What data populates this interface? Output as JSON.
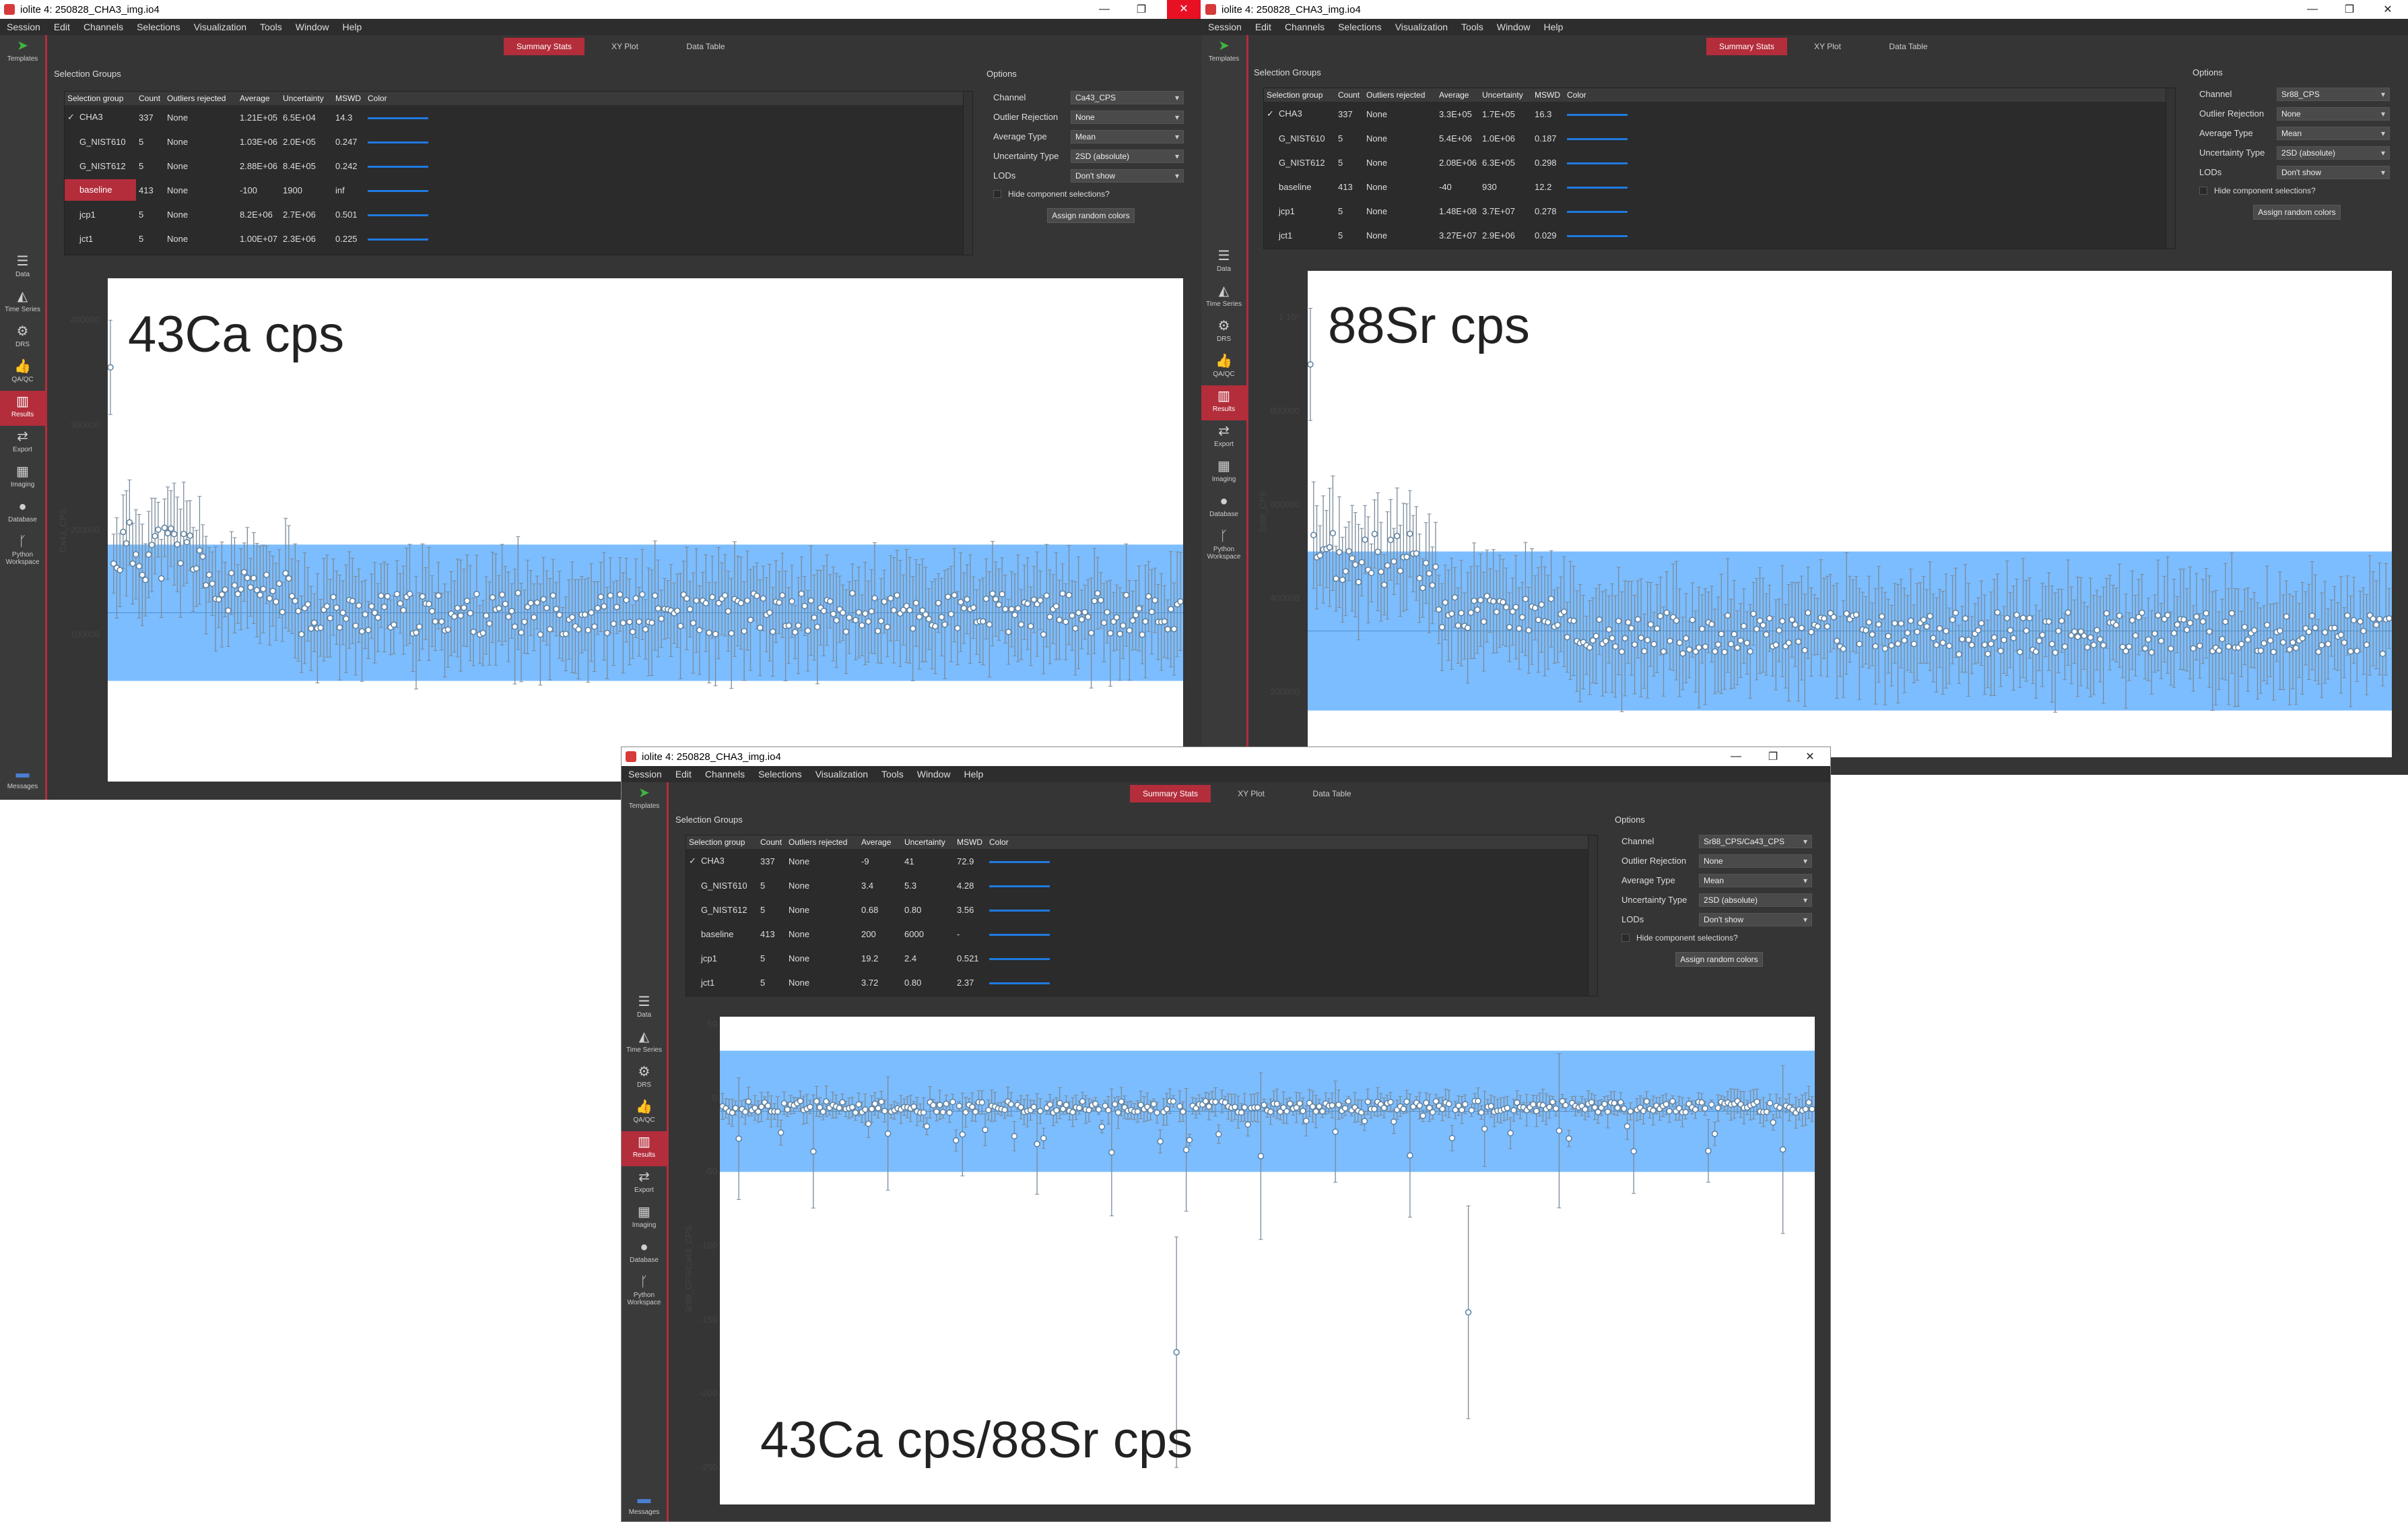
{
  "windows": [
    {
      "id": "w1",
      "title": "iolite 4: 250828_CHA3_img.io4",
      "menu": [
        "Session",
        "Edit",
        "Channels",
        "Selections",
        "Visualization",
        "Tools",
        "Window",
        "Help"
      ],
      "tabs": [
        "Summary Stats",
        "XY Plot",
        "Data Table"
      ],
      "sidebar": [
        "Templates",
        "Data",
        "Time Series",
        "DRS",
        "QA/QC",
        "Results",
        "Export",
        "Imaging",
        "Database",
        "Python Workspace",
        "Messages"
      ],
      "selection_groups_title": "Selection Groups",
      "table_headers": [
        "Selection group",
        "Count",
        "Outliers rejected",
        "Average",
        "Uncertainty",
        "MSWD",
        "Color"
      ],
      "rows": [
        {
          "check": "✓",
          "name": "CHA3",
          "count": "337",
          "outliers": "None",
          "avg": "1.21E+05",
          "unc": "6.5E+04",
          "mswd": "14.3"
        },
        {
          "check": "",
          "name": "G_NIST610",
          "count": "5",
          "outliers": "None",
          "avg": "1.03E+06",
          "unc": "2.0E+05",
          "mswd": "0.247"
        },
        {
          "check": "",
          "name": "G_NIST612",
          "count": "5",
          "outliers": "None",
          "avg": "2.88E+06",
          "unc": "8.4E+05",
          "mswd": "0.242"
        },
        {
          "check": "",
          "name": "baseline",
          "count": "413",
          "outliers": "None",
          "avg": "-100",
          "unc": "1900",
          "mswd": "inf"
        },
        {
          "check": "",
          "name": "jcp1",
          "count": "5",
          "outliers": "None",
          "avg": "8.2E+06",
          "unc": "2.7E+06",
          "mswd": "0.501"
        },
        {
          "check": "",
          "name": "jct1",
          "count": "5",
          "outliers": "None",
          "avg": "1.00E+07",
          "unc": "2.3E+06",
          "mswd": "0.225"
        }
      ],
      "options_title": "Options",
      "options": [
        {
          "label": "Channel",
          "value": "Ca43_CPS"
        },
        {
          "label": "Outlier Rejection",
          "value": "None"
        },
        {
          "label": "Average Type",
          "value": "Mean"
        },
        {
          "label": "Uncertainty Type",
          "value": "2SD (absolute)"
        },
        {
          "label": "LODs",
          "value": "Don't show"
        }
      ],
      "hide_label": "Hide component selections?",
      "assign_label": "Assign random colors",
      "overlay_title": "43Ca cps",
      "ylabel": "Ca43_CPS",
      "yticks": [
        "400000",
        "300000",
        "200000",
        "100000"
      ]
    },
    {
      "id": "w2",
      "title": "iolite 4: 250828_CHA3_img.io4",
      "menu": [
        "Session",
        "Edit",
        "Channels",
        "Selections",
        "Visualization",
        "Tools",
        "Window",
        "Help"
      ],
      "tabs": [
        "Summary Stats",
        "XY Plot",
        "Data Table"
      ],
      "sidebar": [
        "Templates",
        "Data",
        "Time Series",
        "DRS",
        "QA/QC",
        "Results",
        "Export",
        "Imaging",
        "Database",
        "Python Workspace"
      ],
      "selection_groups_title": "Selection Groups",
      "table_headers": [
        "Selection group",
        "Count",
        "Outliers rejected",
        "Average",
        "Uncertainty",
        "MSWD",
        "Color"
      ],
      "rows": [
        {
          "check": "✓",
          "name": "CHA3",
          "count": "337",
          "outliers": "None",
          "avg": "3.3E+05",
          "unc": "1.7E+05",
          "mswd": "16.3"
        },
        {
          "check": "",
          "name": "G_NIST610",
          "count": "5",
          "outliers": "None",
          "avg": "5.4E+06",
          "unc": "1.0E+06",
          "mswd": "0.187"
        },
        {
          "check": "",
          "name": "G_NIST612",
          "count": "5",
          "outliers": "None",
          "avg": "2.08E+06",
          "unc": "6.3E+05",
          "mswd": "0.298"
        },
        {
          "check": "",
          "name": "baseline",
          "count": "413",
          "outliers": "None",
          "avg": "-40",
          "unc": "930",
          "mswd": "12.2"
        },
        {
          "check": "",
          "name": "jcp1",
          "count": "5",
          "outliers": "None",
          "avg": "1.48E+08",
          "unc": "3.7E+07",
          "mswd": "0.278"
        },
        {
          "check": "",
          "name": "jct1",
          "count": "5",
          "outliers": "None",
          "avg": "3.27E+07",
          "unc": "2.9E+06",
          "mswd": "0.029"
        }
      ],
      "options_title": "Options",
      "options": [
        {
          "label": "Channel",
          "value": "Sr88_CPS"
        },
        {
          "label": "Outlier Rejection",
          "value": "None"
        },
        {
          "label": "Average Type",
          "value": "Mean"
        },
        {
          "label": "Uncertainty Type",
          "value": "2SD (absolute)"
        },
        {
          "label": "LODs",
          "value": "Don't show"
        }
      ],
      "hide_label": "Hide component selections?",
      "assign_label": "Assign random colors",
      "overlay_title": "88Sr cps",
      "ylabel": "Sr88_CPS",
      "yticks": [
        "1·10⁶",
        "800000",
        "600000",
        "400000",
        "200000"
      ]
    },
    {
      "id": "w3",
      "title": "iolite 4: 250828_CHA3_img.io4",
      "menu": [
        "Session",
        "Edit",
        "Channels",
        "Selections",
        "Visualization",
        "Tools",
        "Window",
        "Help"
      ],
      "tabs": [
        "Summary Stats",
        "XY Plot",
        "Data Table"
      ],
      "sidebar": [
        "Templates",
        "Data",
        "Time Series",
        "DRS",
        "QA/QC",
        "Results",
        "Export",
        "Imaging",
        "Database",
        "Python Workspace",
        "Messages"
      ],
      "selection_groups_title": "Selection Groups",
      "table_headers": [
        "Selection group",
        "Count",
        "Outliers rejected",
        "Average",
        "Uncertainty",
        "MSWD",
        "Color"
      ],
      "rows": [
        {
          "check": "✓",
          "name": "CHA3",
          "count": "337",
          "outliers": "None",
          "avg": "-9",
          "unc": "41",
          "mswd": "72.9"
        },
        {
          "check": "",
          "name": "G_NIST610",
          "count": "5",
          "outliers": "None",
          "avg": "3.4",
          "unc": "5.3",
          "mswd": "4.28"
        },
        {
          "check": "",
          "name": "G_NIST612",
          "count": "5",
          "outliers": "None",
          "avg": "0.68",
          "unc": "0.80",
          "mswd": "3.56"
        },
        {
          "check": "",
          "name": "baseline",
          "count": "413",
          "outliers": "None",
          "avg": "200",
          "unc": "6000",
          "mswd": "-"
        },
        {
          "check": "",
          "name": "jcp1",
          "count": "5",
          "outliers": "None",
          "avg": "19.2",
          "unc": "2.4",
          "mswd": "0.521"
        },
        {
          "check": "",
          "name": "jct1",
          "count": "5",
          "outliers": "None",
          "avg": "3.72",
          "unc": "0.80",
          "mswd": "2.37"
        }
      ],
      "options_title": "Options",
      "options": [
        {
          "label": "Channel",
          "value": "Sr88_CPS/Ca43_CPS"
        },
        {
          "label": "Outlier Rejection",
          "value": "None"
        },
        {
          "label": "Average Type",
          "value": "Mean"
        },
        {
          "label": "Uncertainty Type",
          "value": "2SD (absolute)"
        },
        {
          "label": "LODs",
          "value": "Don't show"
        }
      ],
      "hide_label": "Hide component selections?",
      "assign_label": "Assign random colors",
      "overlay_title": "43Ca cps/88Sr cps",
      "ylabel": "Sr88_CPS/Ca43_CPS",
      "yticks": [
        "50",
        "0",
        "-50",
        "-100",
        "-150",
        "-200",
        "-250"
      ]
    }
  ],
  "colors": {
    "accent": "#b32d3b",
    "band": "#6eb6ff",
    "point": "#5a7fa0",
    "line": "#1f7ae0"
  },
  "chart_data": [
    {
      "type": "scatter",
      "window": "w1",
      "ylabel": "Ca43_CPS",
      "ylim": [
        0,
        400000
      ],
      "mean": 121000,
      "band": [
        56000,
        186000
      ],
      "n_points": 337
    },
    {
      "type": "scatter",
      "window": "w2",
      "ylabel": "Sr88_CPS",
      "ylim": [
        0,
        1000000
      ],
      "mean": 330000,
      "band": [
        160000,
        500000
      ],
      "n_points": 337
    },
    {
      "type": "scatter",
      "window": "w3",
      "ylabel": "Sr88_CPS/Ca43_CPS",
      "ylim": [
        -250,
        50
      ],
      "mean": -9,
      "band": [
        -50,
        32
      ],
      "n_points": 337
    }
  ]
}
